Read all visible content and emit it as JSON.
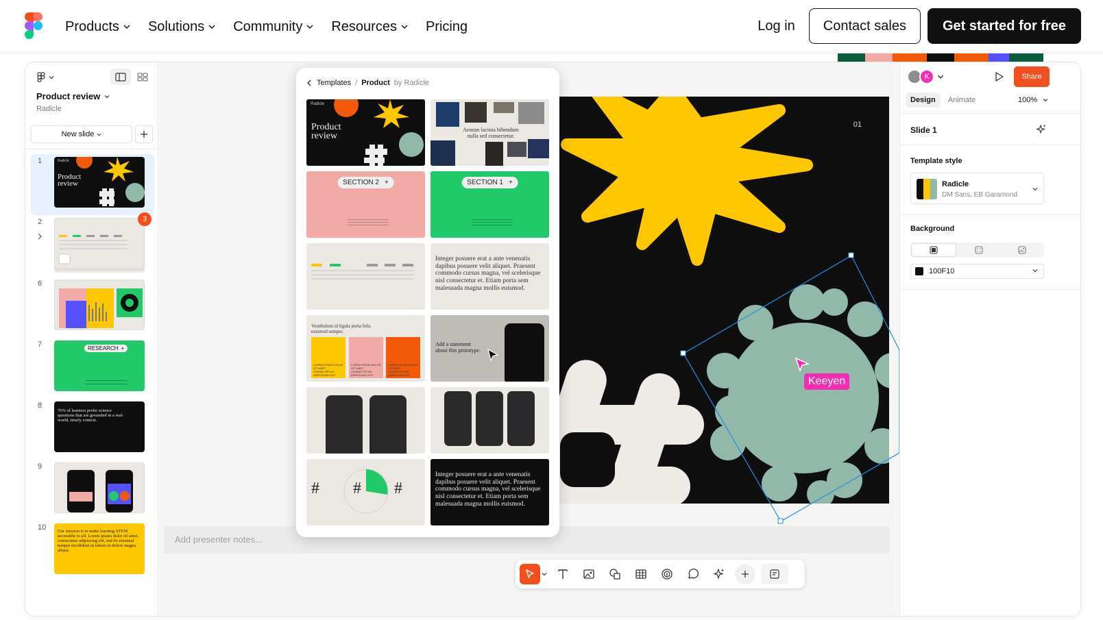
{
  "nav": {
    "items": [
      {
        "label": "Products",
        "dropdown": true
      },
      {
        "label": "Solutions",
        "dropdown": true
      },
      {
        "label": "Community",
        "dropdown": true
      },
      {
        "label": "Resources",
        "dropdown": true
      },
      {
        "label": "Pricing",
        "dropdown": false
      }
    ],
    "login": "Log in",
    "contact_sales": "Contact sales",
    "get_started": "Get started for free"
  },
  "left_panel": {
    "doc_title": "Product review",
    "doc_subtitle": "Radicle",
    "new_slide": "New slide",
    "slides": [
      {
        "num": "1",
        "kind": "cover",
        "title": "Product review",
        "brand": "Radicle",
        "selected": true
      },
      {
        "num": "2",
        "kind": "table",
        "badge": "3"
      },
      {
        "num": "6",
        "kind": "charts"
      },
      {
        "num": "7",
        "kind": "section",
        "pill": "RESEARCH"
      },
      {
        "num": "8",
        "kind": "quote",
        "text": "76% of learners prefer science questions that are grounded in a real-world, timely context."
      },
      {
        "num": "9",
        "kind": "phones"
      },
      {
        "num": "10",
        "kind": "mission",
        "text": "Our mission is to make learning STEM accessible to all. Lorem ipsum dolor sit amet, consectetur adipiscing elit, sed do eiusmod tempor incididunt ut labore et dolore magna aliqua."
      }
    ]
  },
  "templates": {
    "breadcrumb_root": "Templates",
    "breadcrumb_sep": "/",
    "breadcrumb_current": "Product",
    "breadcrumb_by": "by Radicle",
    "cover": {
      "brand": "Radicle",
      "title": "Product review"
    },
    "caption_card": "Aenean lacinia bibendum nulla sed consectetur.",
    "section2": "SECTION 2",
    "section1": "SECTION 1",
    "body_text": "Integer posuere erat a ante venenatis dapibus posuere velit aliquet. Praesent commodo cursus magna, vel scelerisque nisl consectetur et. Etiam porta sem malesuada magna mollis euismod.",
    "vestibulum": "Vestibulum id ligula porta felis euismod semper.",
    "lorem_caption": "LOREM IPSUM DOLOR SIT AMET, CONSECTETUR ADIPISCING ELIT",
    "statement": "Add a statement about this prototype.",
    "hash": "#"
  },
  "canvas": {
    "slide_number": "01",
    "cursor_name": "Keeyen",
    "notes_placeholder": "Add presenter notes...",
    "bg_color": "#100f10"
  },
  "toolbar": {
    "tools": [
      "select-tool",
      "text-tool",
      "image-tool",
      "shapes-tool",
      "table-tool",
      "sticker-tool",
      "comment-tool",
      "ai-tool",
      "more-tool"
    ]
  },
  "right_panel": {
    "avatar_letter": "K",
    "share": "Share",
    "tab_design": "Design",
    "tab_animate": "Animate",
    "zoom": "100%",
    "slide_name": "Slide 1",
    "template_style_label": "Template style",
    "style_name": "Radicle",
    "style_fonts": "DM Sans, EB Garamond",
    "background_label": "Background",
    "bg_hex": "100F10"
  },
  "colors": {
    "accent": "#f24e1e",
    "cursor": "#f32eb3",
    "selection": "#2a8de8",
    "yellow": "#ffc700",
    "sage": "#92b8a9",
    "orange": "#f15a0b",
    "pink": "#f2aaa6",
    "green": "#22c969"
  }
}
